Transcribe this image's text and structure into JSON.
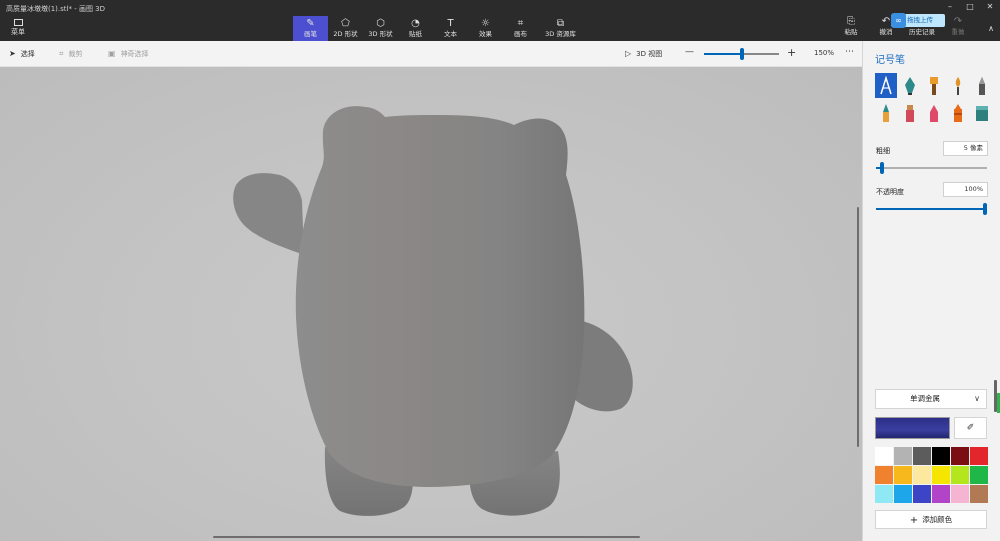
{
  "window": {
    "title": "高质量冰墩墩(1).stl* - 画图 3D",
    "controls": [
      "–",
      "□",
      "✕"
    ]
  },
  "menu": {
    "label": "菜单",
    "icon": "folder-icon"
  },
  "toolbar": {
    "tools": [
      {
        "label": "画笔",
        "icon": "brush-icon",
        "glyph": "✎",
        "active": true
      },
      {
        "label": "2D 形状",
        "icon": "shapes-2d-icon",
        "glyph": "⬠",
        "active": false
      },
      {
        "label": "3D 形状",
        "icon": "cube-icon",
        "glyph": "⬡",
        "active": false
      },
      {
        "label": "贴纸",
        "icon": "sticker-icon",
        "glyph": "◔",
        "active": false
      },
      {
        "label": "文本",
        "icon": "text-icon",
        "glyph": "T",
        "active": false
      },
      {
        "label": "效果",
        "icon": "effects-icon",
        "glyph": "☼",
        "active": false
      },
      {
        "label": "画布",
        "icon": "canvas-icon",
        "glyph": "⌗",
        "active": false
      },
      {
        "label": "3D 资源库",
        "icon": "library-3d-icon",
        "glyph": "⧉",
        "active": false
      }
    ],
    "paste": "粘贴",
    "undo": "撤消",
    "history": "历史记录",
    "redo": "重做",
    "upload_popup": "拖拽上传"
  },
  "subbar": {
    "select": "选择",
    "crop": "裁剪",
    "magic_select": "神奇选择",
    "view3d": "3D 视图",
    "zoom_minus": "—",
    "zoom_plus": "+",
    "zoom_level": "150%",
    "zoom_fraction": 0.5,
    "more": "⋯"
  },
  "panel": {
    "title": "记号笔",
    "thickness_label": "粗细",
    "thickness_value": "5 像素",
    "thickness_fraction": 0.05,
    "opacity_label": "不透明度",
    "opacity_value": "100%",
    "opacity_fraction": 1.0,
    "material": "单调金属",
    "current_color": "#2b2f87",
    "add_color": "添加颜色",
    "brushes": [
      {
        "name": "marker-brush-icon",
        "active": true
      },
      {
        "name": "calligraphy-pen-icon",
        "active": false
      },
      {
        "name": "oil-brush-icon",
        "active": false
      },
      {
        "name": "watercolor-brush-icon",
        "active": false
      },
      {
        "name": "pencil-icon",
        "active": false
      },
      {
        "name": "pixel-pen-icon",
        "active": false
      },
      {
        "name": "spray-can-icon",
        "active": false
      },
      {
        "name": "eraser-icon",
        "active": false
      },
      {
        "name": "crayon-icon",
        "active": false
      },
      {
        "name": "fill-bucket-icon",
        "active": false
      }
    ],
    "palette": [
      "#ffffff",
      "#b3b3b3",
      "#5c5c5c",
      "#000000",
      "#7a0e12",
      "#e3262c",
      "#f0812f",
      "#f6b81c",
      "#fde8a0",
      "#f5e500",
      "#b4e61e",
      "#1fb748",
      "#8fe9f4",
      "#1da6ea",
      "#3b45c6",
      "#b144c7",
      "#f5b4d2",
      "#b17a55"
    ]
  }
}
